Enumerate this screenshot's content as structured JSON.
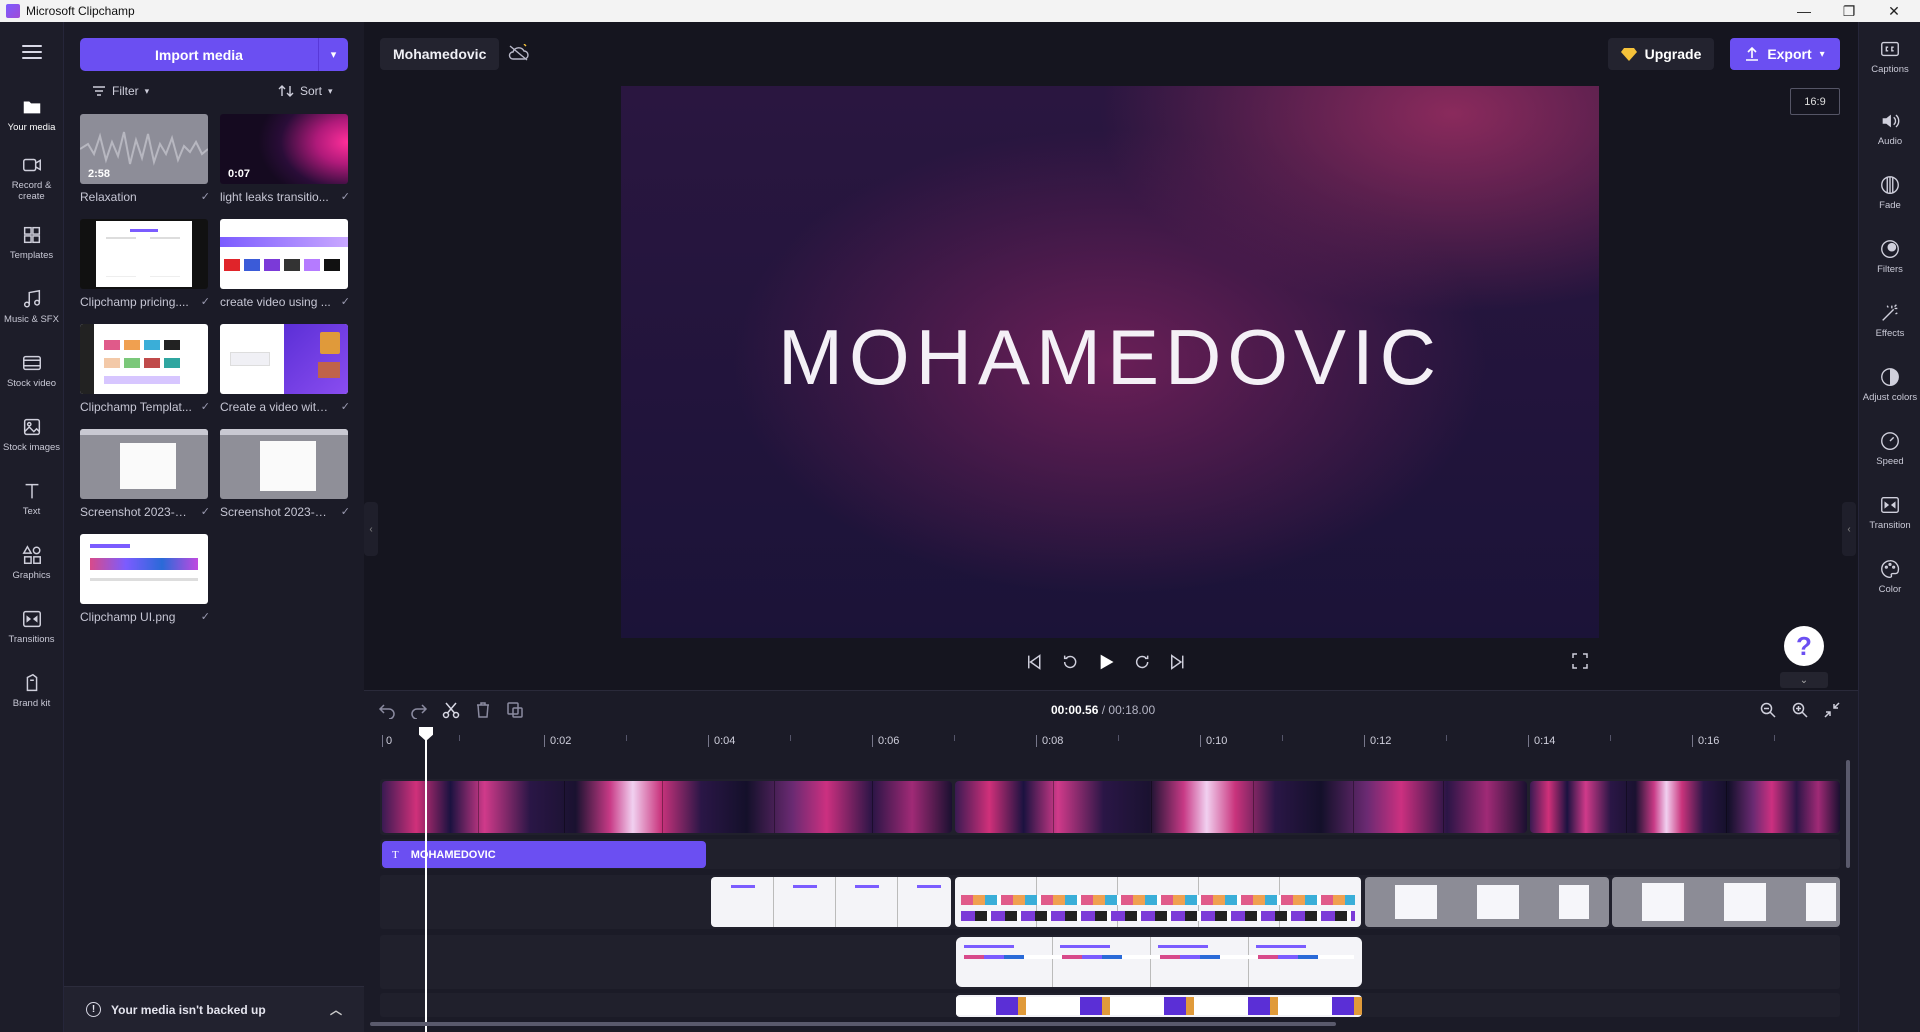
{
  "window": {
    "title": "Microsoft Clipchamp",
    "controls": [
      "—",
      "❐",
      "✕"
    ]
  },
  "left_rail": {
    "items": [
      {
        "label": "Your media",
        "icon": "folder-icon",
        "active": true
      },
      {
        "label": "Record & create",
        "icon": "camera-icon"
      },
      {
        "label": "Templates",
        "icon": "templates-icon"
      },
      {
        "label": "Music & SFX",
        "icon": "music-icon"
      },
      {
        "label": "Stock video",
        "icon": "film-icon"
      },
      {
        "label": "Stock images",
        "icon": "image-icon"
      },
      {
        "label": "Text",
        "icon": "text-icon"
      },
      {
        "label": "Graphics",
        "icon": "shapes-icon"
      },
      {
        "label": "Transitions",
        "icon": "transition-icon"
      },
      {
        "label": "Brand kit",
        "icon": "brand-icon"
      }
    ]
  },
  "media_panel": {
    "import_label": "Import media",
    "filter_label": "Filter",
    "sort_label": "Sort",
    "items": [
      {
        "name": "Relaxation",
        "duration": "2:58",
        "kind": "audio"
      },
      {
        "name": "light leaks transitio...",
        "duration": "0:07",
        "kind": "gradient"
      },
      {
        "name": "Clipchamp pricing....",
        "duration": "",
        "kind": "pricing"
      },
      {
        "name": "create video using ...",
        "duration": "",
        "kind": "create"
      },
      {
        "name": "Clipchamp Templat...",
        "duration": "",
        "kind": "templates"
      },
      {
        "name": "Create a video with ...",
        "duration": "",
        "kind": "purple"
      },
      {
        "name": "Screenshot 2023-10...",
        "duration": "",
        "kind": "screenshot"
      },
      {
        "name": "Screenshot 2023-10...",
        "duration": "",
        "kind": "screenshot"
      },
      {
        "name": "Clipchamp UI.png",
        "duration": "",
        "kind": "ui"
      }
    ],
    "backup_text": "Your media isn't backed up"
  },
  "header": {
    "project_name": "Mohamedovic",
    "upgrade_label": "Upgrade",
    "export_label": "Export",
    "aspect_ratio": "16:9"
  },
  "preview": {
    "text": "MOHAMEDOVIC"
  },
  "help": {
    "label": "?"
  },
  "right_rail": {
    "items": [
      {
        "label": "Captions",
        "icon": "captions-icon"
      },
      {
        "label": "Audio",
        "icon": "speaker-icon"
      },
      {
        "label": "Fade",
        "icon": "fade-icon"
      },
      {
        "label": "Filters",
        "icon": "filters-icon"
      },
      {
        "label": "Effects",
        "icon": "effects-icon"
      },
      {
        "label": "Adjust colors",
        "icon": "adjust-icon"
      },
      {
        "label": "Speed",
        "icon": "speed-icon"
      },
      {
        "label": "Transition",
        "icon": "transition-icon"
      },
      {
        "label": "Color",
        "icon": "palette-icon"
      }
    ]
  },
  "timeline": {
    "current_time": "00:00.56",
    "separator": "/",
    "total_time": "00:18.00",
    "ruler_labels": [
      "0",
      "0:02",
      "0:04",
      "0:06",
      "0:08",
      "0:10",
      "0:12",
      "0:14",
      "0:16"
    ],
    "text_clip_label": "MOHAMEDOVIC"
  },
  "colors": {
    "accent": "#6b4ff2",
    "panel": "#1b1b27",
    "rail": "#1d1d29"
  }
}
